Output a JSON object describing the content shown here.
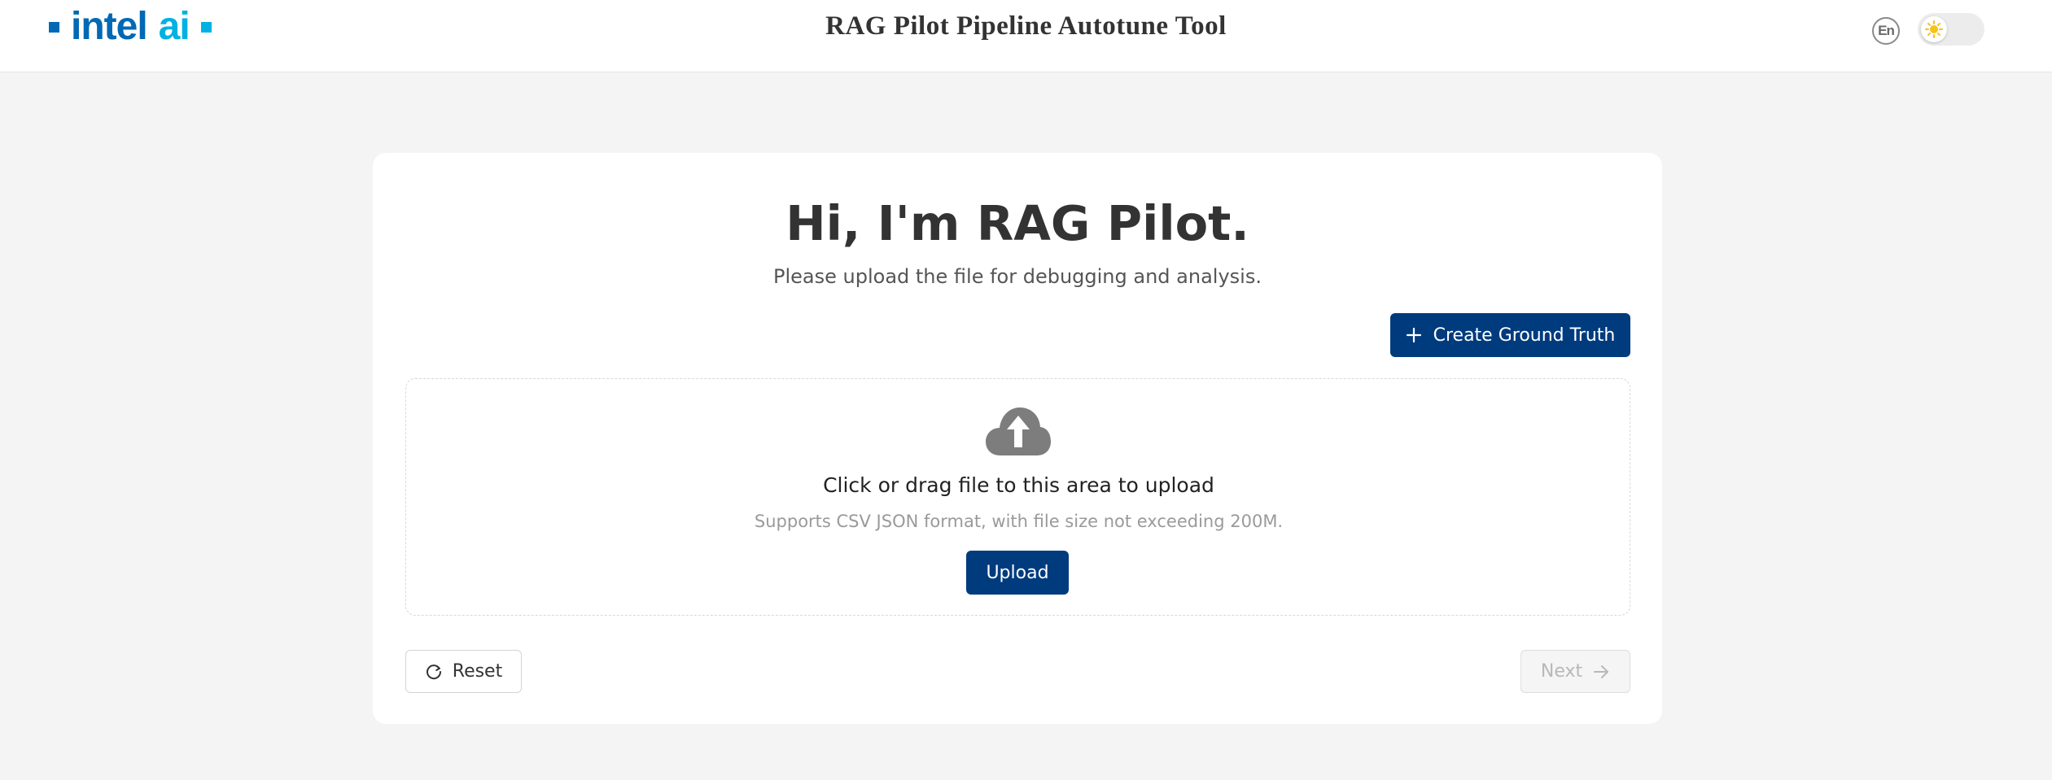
{
  "header": {
    "logo": {
      "primary": "intel",
      "secondary": "ai"
    },
    "title": "RAG Pilot Pipeline Autotune Tool",
    "language_label": "En",
    "theme_toggle": {
      "mode": "light",
      "icon": "sun-icon"
    }
  },
  "main": {
    "heading": "Hi, I'm RAG Pilot.",
    "subheading": "Please upload the file for debugging and analysis.",
    "create_ground_truth_label": "Create Ground Truth",
    "upload_area": {
      "icon": "cloud-upload-icon",
      "title": "Click or drag file to this area to upload",
      "hint": "Supports CSV JSON format, with file size not exceeding 200M.",
      "upload_label": "Upload"
    },
    "reset_label": "Reset",
    "next_label": "Next",
    "next_disabled": true
  },
  "colors": {
    "primary": "#003b7e",
    "intel_blue": "#0068b5",
    "intel_ai_cyan": "#00b2e3",
    "page_bg": "#f4f4f4",
    "sun": "#f7c21a"
  }
}
